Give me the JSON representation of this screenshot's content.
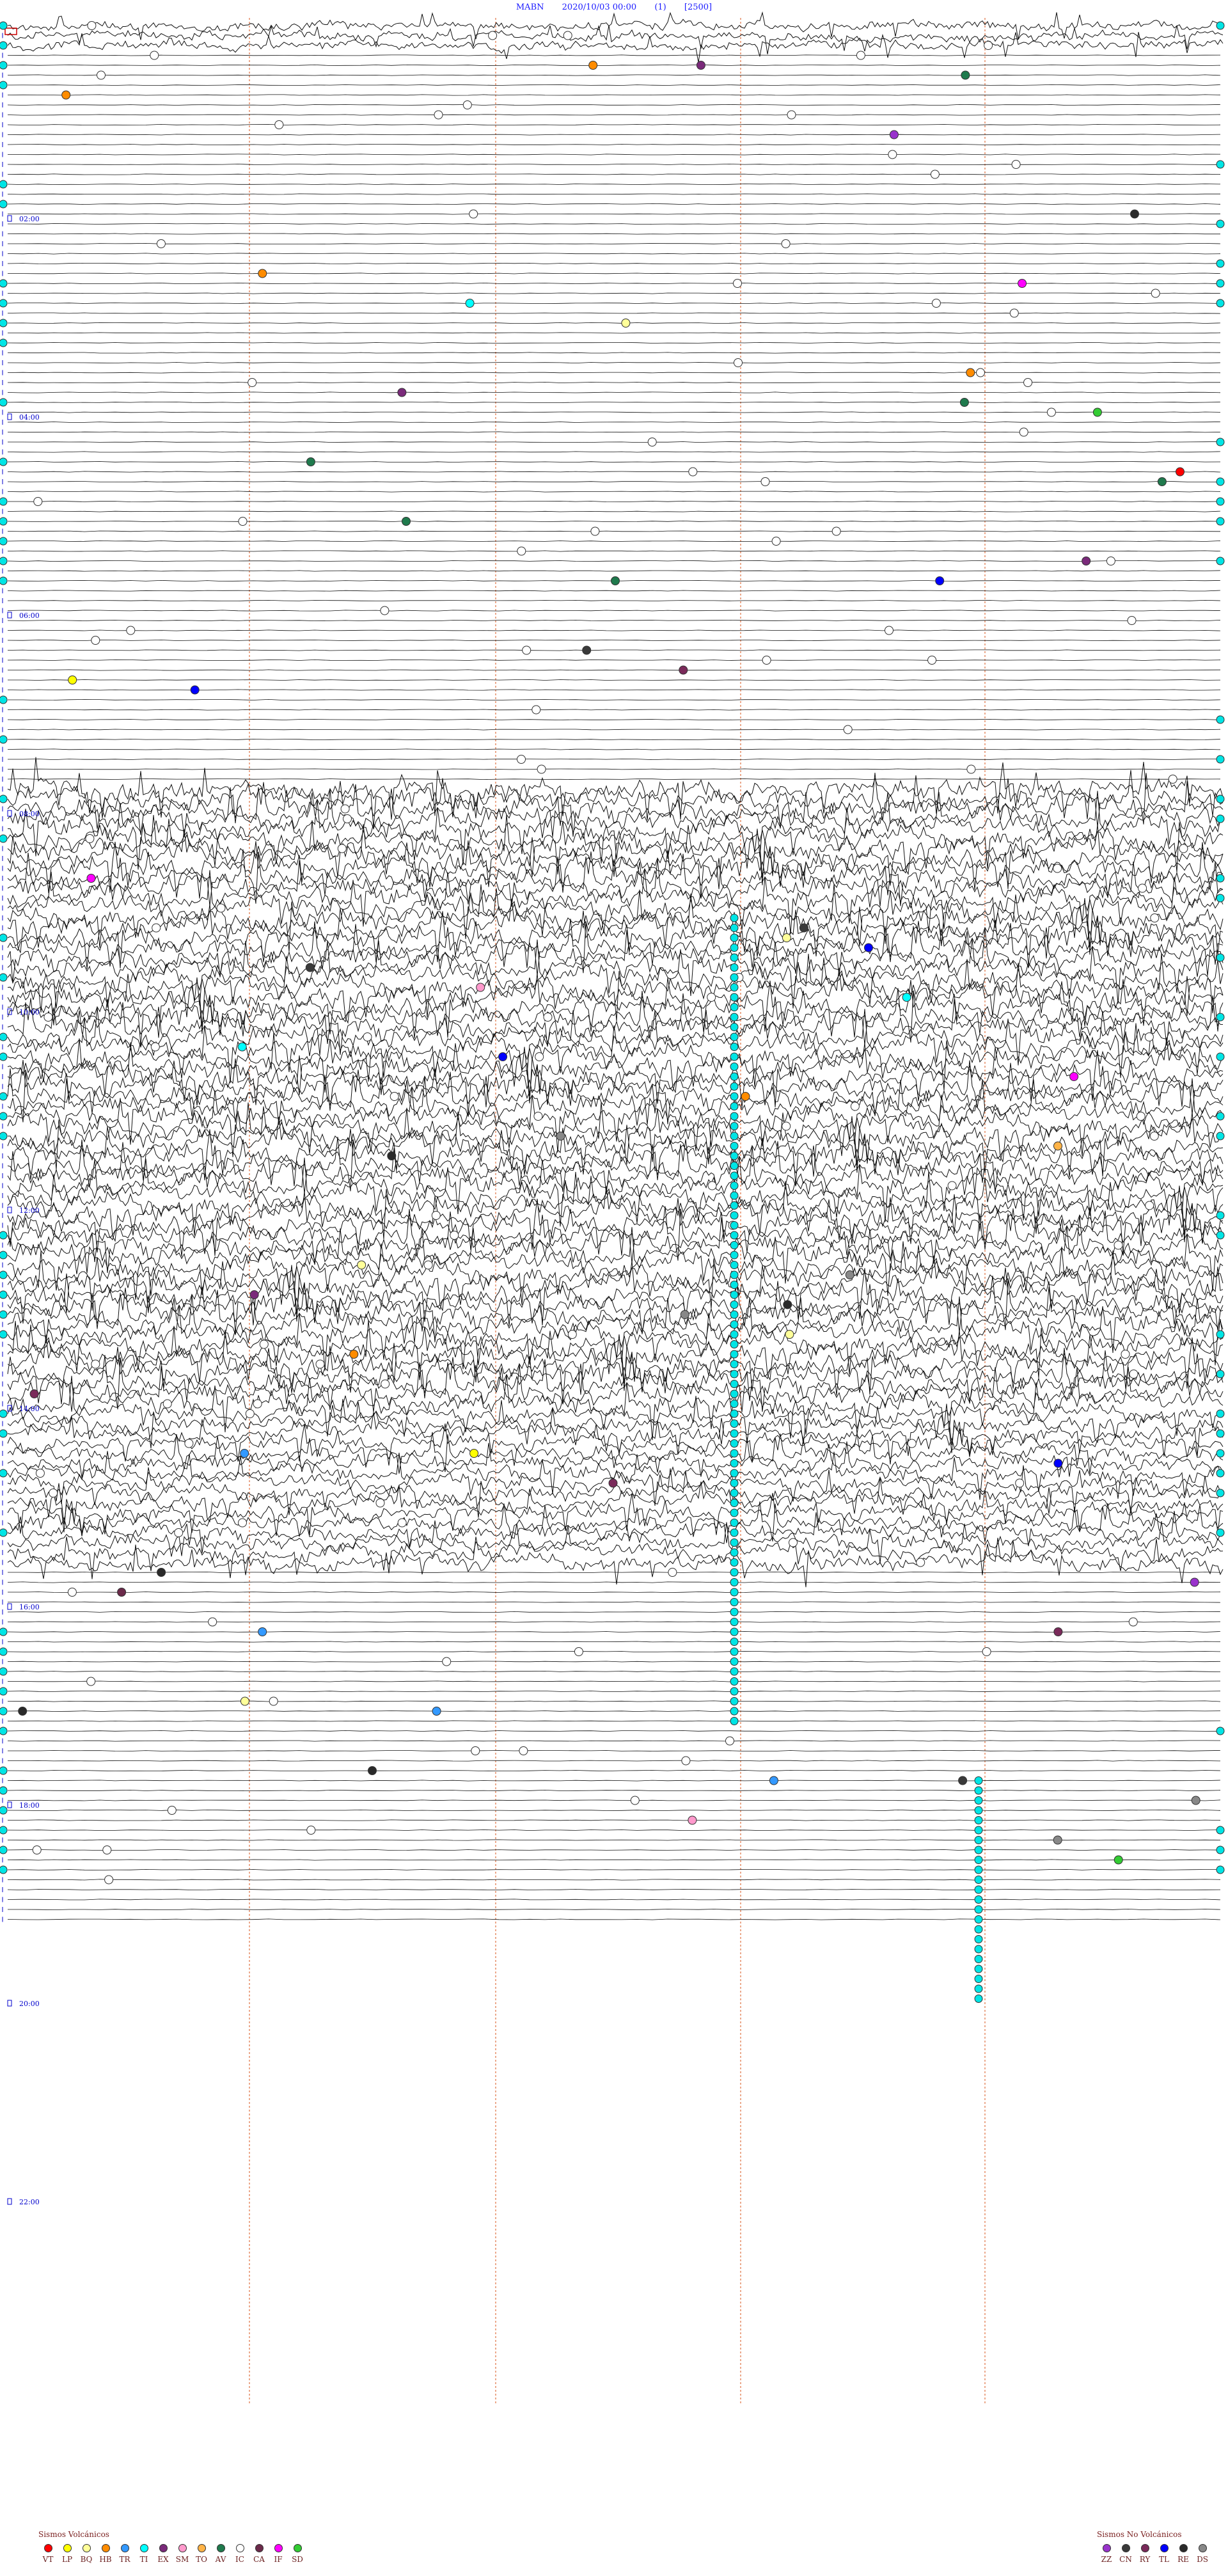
{
  "header": {
    "station": "MABN",
    "datetime": "2020/10/03 00:00",
    "channel": "(1)",
    "scale": "[2500]"
  },
  "hour_labels": [
    "02:00",
    "04:00",
    "06:00",
    "08:00",
    "10:00",
    "12:00",
    "14:00",
    "16:00",
    "18:00",
    "20:00",
    "22:00"
  ],
  "legend_volcanic": {
    "title": "Sismos Volcánicos",
    "items": [
      {
        "code": "VT",
        "color": "#ff0000"
      },
      {
        "code": "LP",
        "color": "#ffff00"
      },
      {
        "code": "BQ",
        "color": "#ffff99"
      },
      {
        "code": "HB",
        "color": "#ff8c00"
      },
      {
        "code": "TR",
        "color": "#3399ff"
      },
      {
        "code": "TI",
        "color": "#00ffff"
      },
      {
        "code": "EX",
        "color": "#7a2a7a"
      },
      {
        "code": "SM",
        "color": "#ff99cc"
      },
      {
        "code": "TO",
        "color": "#ffb347"
      },
      {
        "code": "AV",
        "color": "#1f7a4d"
      },
      {
        "code": "IC",
        "color": "#ffffff"
      },
      {
        "code": "CA",
        "color": "#6b2a4a"
      },
      {
        "code": "IF",
        "color": "#ff00ff"
      },
      {
        "code": "SD",
        "color": "#33cc33"
      }
    ]
  },
  "legend_nonvolcanic": {
    "title": "Sismos No Volcánicos",
    "items": [
      {
        "code": "ZZ",
        "color": "#9933cc"
      },
      {
        "code": "CN",
        "color": "#3a3a3a"
      },
      {
        "code": "RY",
        "color": "#7a2a5a"
      },
      {
        "code": "TL",
        "color": "#0000ff"
      },
      {
        "code": "RE",
        "color": "#2a2a2a"
      },
      {
        "code": "DS",
        "color": "#888888"
      }
    ]
  },
  "colors": {
    "trace": "#111111",
    "hour_marker": "#0000cc",
    "minute_line": "#e07040",
    "start_marker": "#cc0000"
  }
}
